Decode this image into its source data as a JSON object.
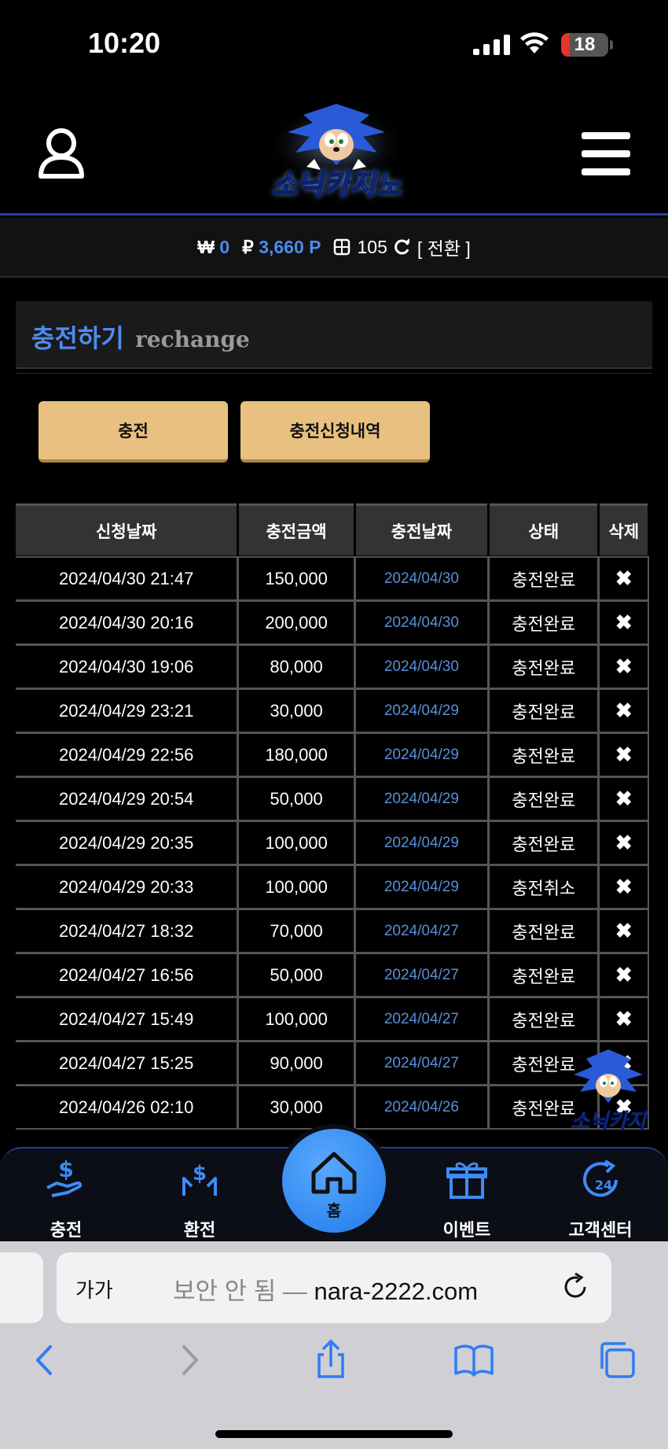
{
  "status": {
    "time": "10:20",
    "battery": "18",
    "battery_level_percent": 18
  },
  "header": {
    "logo_text": "소닉카지노"
  },
  "balance": {
    "won_symbol": "₩",
    "won_value": "0",
    "point_symbol": "₽",
    "point_value": "3,660 P",
    "chip_value": "105",
    "convert_label": "[ 전환 ]"
  },
  "section": {
    "title_ko": "충전하기",
    "title_en": "rechange"
  },
  "buttons": {
    "charge": "충전",
    "history": "충전신청내역"
  },
  "table": {
    "headers": [
      "신청날짜",
      "충전금액",
      "충전날짜",
      "상태",
      "삭제"
    ],
    "rows": [
      {
        "req": "2024/04/30 21:47",
        "amount": "150,000",
        "date": "2024/04/30",
        "status": "충전완료"
      },
      {
        "req": "2024/04/30 20:16",
        "amount": "200,000",
        "date": "2024/04/30",
        "status": "충전완료"
      },
      {
        "req": "2024/04/30 19:06",
        "amount": "80,000",
        "date": "2024/04/30",
        "status": "충전완료"
      },
      {
        "req": "2024/04/29 23:21",
        "amount": "30,000",
        "date": "2024/04/29",
        "status": "충전완료"
      },
      {
        "req": "2024/04/29 22:56",
        "amount": "180,000",
        "date": "2024/04/29",
        "status": "충전완료"
      },
      {
        "req": "2024/04/29 20:54",
        "amount": "50,000",
        "date": "2024/04/29",
        "status": "충전완료"
      },
      {
        "req": "2024/04/29 20:35",
        "amount": "100,000",
        "date": "2024/04/29",
        "status": "충전완료"
      },
      {
        "req": "2024/04/29 20:33",
        "amount": "100,000",
        "date": "2024/04/29",
        "status": "충전취소"
      },
      {
        "req": "2024/04/27 18:32",
        "amount": "70,000",
        "date": "2024/04/27",
        "status": "충전완료"
      },
      {
        "req": "2024/04/27 16:56",
        "amount": "50,000",
        "date": "2024/04/27",
        "status": "충전완료"
      },
      {
        "req": "2024/04/27 15:49",
        "amount": "100,000",
        "date": "2024/04/27",
        "status": "충전완료"
      },
      {
        "req": "2024/04/27 15:25",
        "amount": "90,000",
        "date": "2024/04/27",
        "status": "충전완료"
      },
      {
        "req": "2024/04/26 02:10",
        "amount": "30,000",
        "date": "2024/04/26",
        "status": "충전완료"
      }
    ],
    "delete_glyph": "✖"
  },
  "bottom_nav": {
    "items": [
      {
        "label": "충전",
        "icon": "hand-dollar-icon"
      },
      {
        "label": "환전",
        "icon": "exchange-hand-icon"
      },
      {
        "label": "홈",
        "icon": "home-icon"
      },
      {
        "label": "이벤트",
        "icon": "gift-icon"
      },
      {
        "label": "고객센터",
        "icon": "support-24-icon"
      }
    ]
  },
  "browser": {
    "aa_label": "가가",
    "url_prefix": "보안 안 됨 — ",
    "url_domain": "nara-2222.com"
  },
  "colors": {
    "accent_blue": "#4a8cf0",
    "gold_button": "#e8c07f",
    "nav_border": "#2c3f9e"
  }
}
